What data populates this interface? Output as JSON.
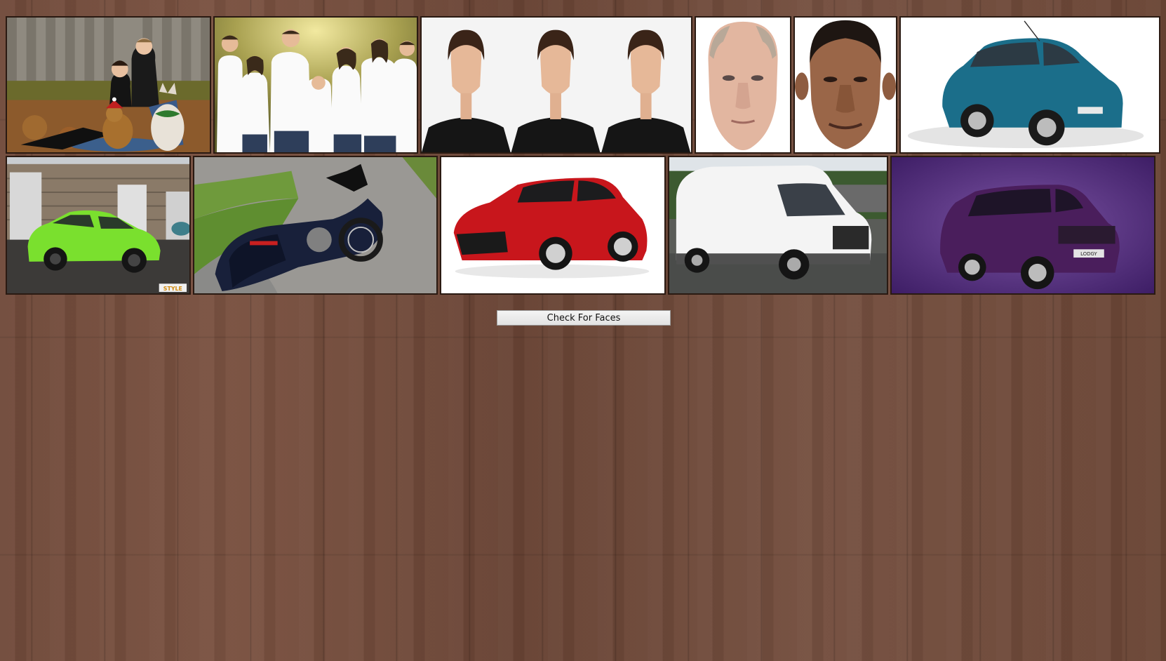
{
  "gallery": {
    "images": [
      {
        "subject": "couple-with-dogs-photo"
      },
      {
        "subject": "family-portrait-photo"
      },
      {
        "subject": "three-faces-photo"
      },
      {
        "subject": "putin-face-mask"
      },
      {
        "subject": "obama-face-mask"
      },
      {
        "subject": "blue-hatchback-photo"
      },
      {
        "subject": "green-hatchback-photo",
        "watermark": "STYLE"
      },
      {
        "subject": "motorcycle-photo"
      },
      {
        "subject": "red-hatchback-photo"
      },
      {
        "subject": "white-van-photo"
      },
      {
        "subject": "purple-minivan-photo",
        "plate": "LODGY"
      }
    ]
  },
  "actions": {
    "check_faces_label": "Check For Faces"
  },
  "colors": {
    "background_wood": "#6b4536",
    "thumb_border": "#2a1a12"
  }
}
